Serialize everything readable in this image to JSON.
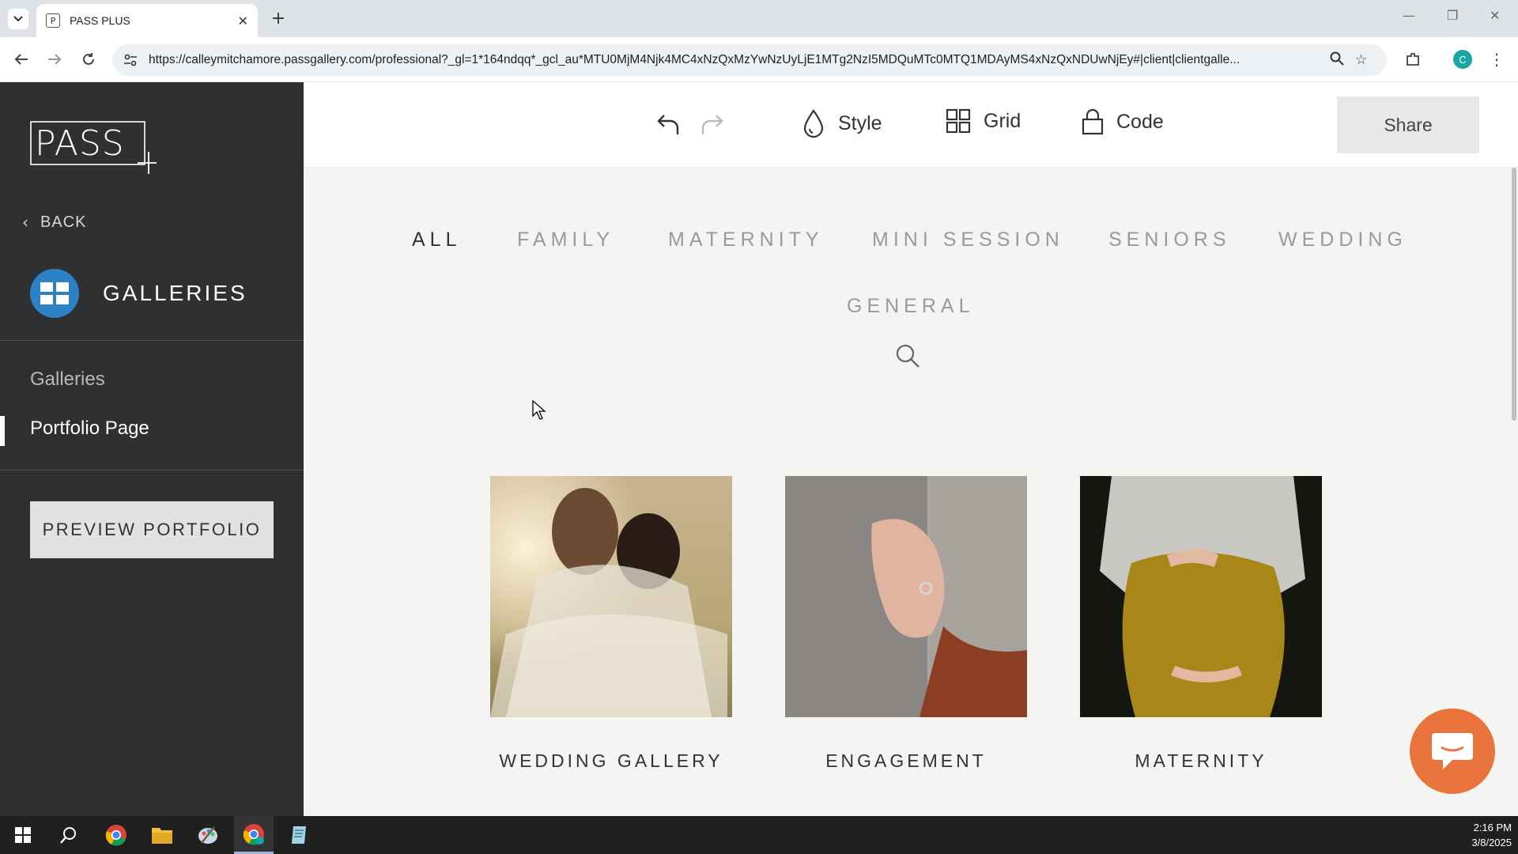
{
  "browser": {
    "tab_title": "PASS PLUS",
    "tab_favicon_letter": "P",
    "url": "https://calleymitchamore.passgallery.com/professional?_gl=1*164ndqq*_gcl_au*MTU0MjM4Njk4MC4xNzQxMzYwNzUyLjE1MTg2NzI5MDQuMTc0MTQ1MDAyMS4xNzQxNDUwNjEy#|client|clientgalle...",
    "profile_initial": "C",
    "accent_color": "#18a7a5"
  },
  "sidebar": {
    "logo_text": "PASS",
    "back_label": "BACK",
    "section_title": "GALLERIES",
    "section_icon": "grid-icon",
    "items": [
      {
        "label": "Galleries",
        "active": false
      },
      {
        "label": "Portfolio Page",
        "active": true
      }
    ],
    "preview_button": "PREVIEW PORTFOLIO",
    "background": "#2f3031",
    "icon_color": "#2d82c6"
  },
  "toolbar": {
    "style_label": "Style",
    "grid_label": "Grid",
    "code_label": "Code",
    "share_label": "Share"
  },
  "portfolio": {
    "categories": [
      {
        "label": "ALL",
        "active": true
      },
      {
        "label": "FAMILY",
        "active": false
      },
      {
        "label": "MATERNITY",
        "active": false
      },
      {
        "label": "MINI SESSION",
        "active": false
      },
      {
        "label": "SENIORS",
        "active": false
      },
      {
        "label": "WEDDING",
        "active": false
      },
      {
        "label": "GENERAL",
        "active": false
      }
    ],
    "galleries": [
      {
        "title": "WEDDING GALLERY"
      },
      {
        "title": "ENGAGEMENT"
      },
      {
        "title": "MATERNITY"
      }
    ],
    "chat_color": "#e8743c"
  },
  "taskbar": {
    "time": "2:16 PM",
    "date": "3/8/2025"
  }
}
